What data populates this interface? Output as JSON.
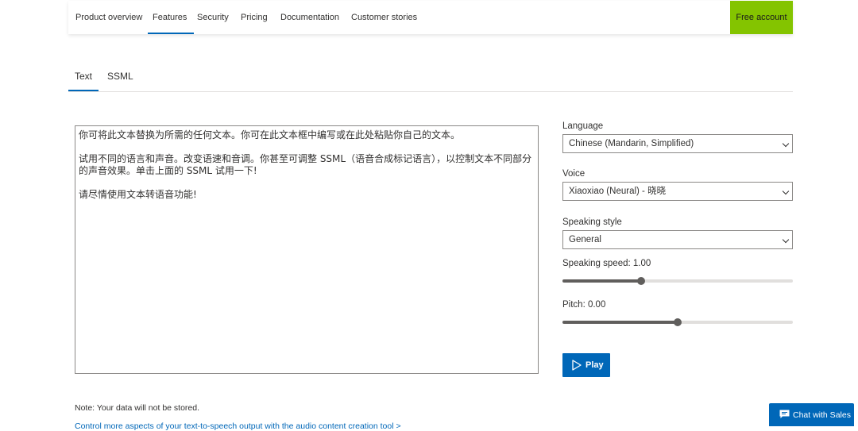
{
  "nav": {
    "items": [
      "Product overview",
      "Features",
      "Security",
      "Pricing",
      "Documentation",
      "Customer stories"
    ],
    "active_index": 1,
    "cta_label": "Free account",
    "cta_color": "#84c400"
  },
  "tabs": {
    "items": [
      "Text",
      "SSML"
    ],
    "active_index": 0
  },
  "editor": {
    "text": "你可将此文本替换为所需的任何文本。你可在此文本框中编写或在此处粘贴你自己的文本。\n\n试用不同的语言和声音。改变语速和音调。你甚至可调整 SSML（语音合成标记语言），以控制文本不同部分的声音效果。单击上面的 SSML 试用一下!\n\n请尽情使用文本转语音功能!"
  },
  "settings": {
    "language_label": "Language",
    "language_value": "Chinese (Mandarin, Simplified)",
    "voice_label": "Voice",
    "voice_value": "Xiaoxiao (Neural) - 晓晓",
    "style_label": "Speaking style",
    "style_value": "General",
    "speed_label": "Speaking speed: 1.00",
    "speed_fraction": 0.34,
    "pitch_label": "Pitch: 0.00",
    "pitch_fraction": 0.5,
    "play_label": "Play"
  },
  "footer": {
    "note": "Note: Your data will not be stored.",
    "link": "Control more aspects of your text-to-speech output with the audio content creation tool >",
    "chat_label": "Chat with Sales"
  },
  "colors": {
    "accent": "#0067b8"
  }
}
